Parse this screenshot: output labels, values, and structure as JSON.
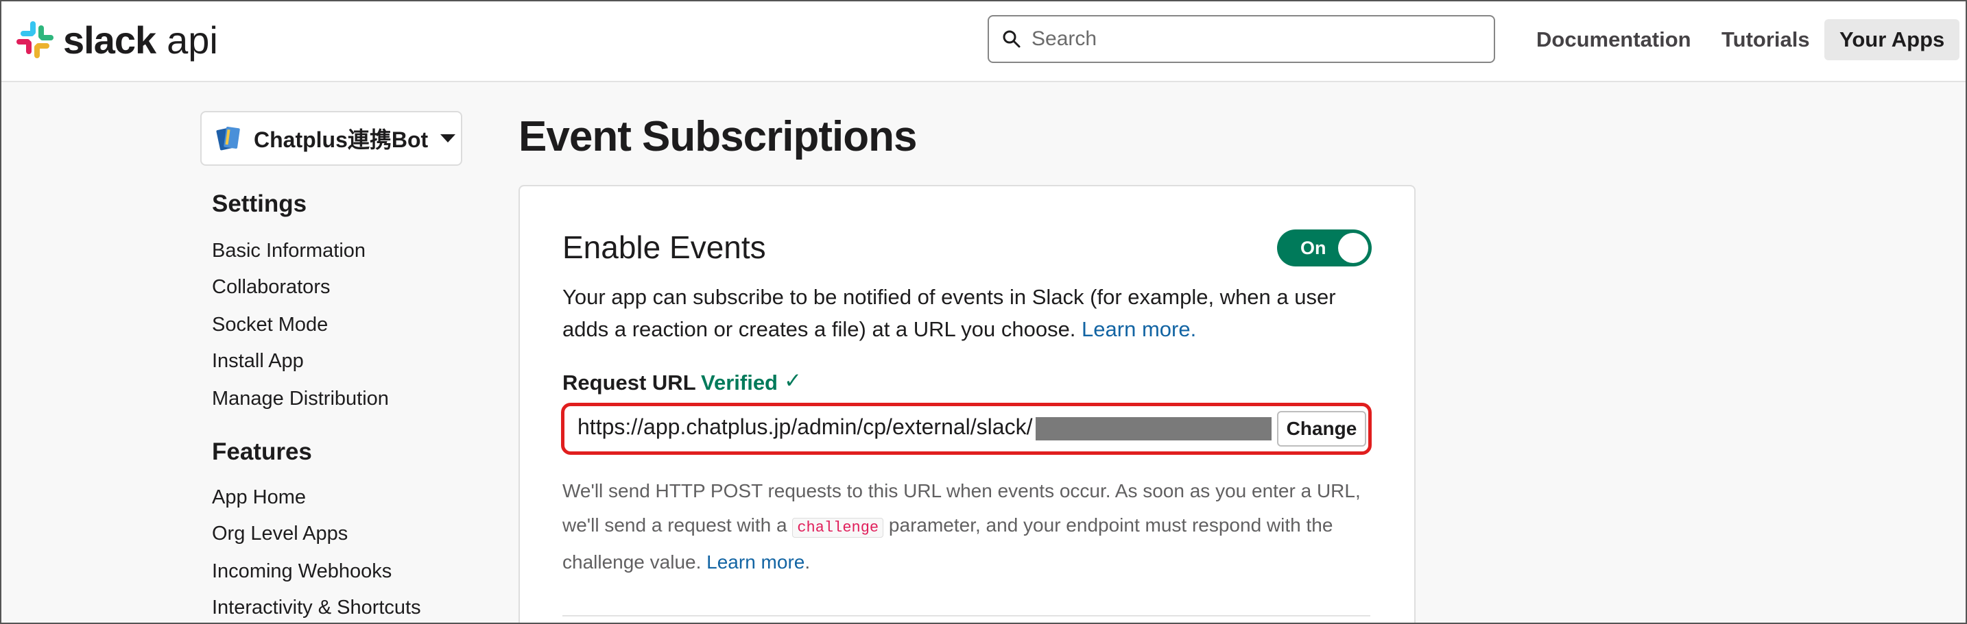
{
  "header": {
    "logo_word": "slack",
    "logo_suffix": "api",
    "search_placeholder": "Search",
    "nav": [
      "Documentation",
      "Tutorials",
      "Your Apps"
    ],
    "active_nav": "Your Apps"
  },
  "sidebar": {
    "app_name": "Chatplus連携Bot",
    "sections": [
      {
        "heading": "Settings",
        "items": [
          "Basic Information",
          "Collaborators",
          "Socket Mode",
          "Install App",
          "Manage Distribution"
        ]
      },
      {
        "heading": "Features",
        "items": [
          "App Home",
          "Org Level Apps",
          "Incoming Webhooks",
          "Interactivity & Shortcuts"
        ]
      }
    ]
  },
  "main": {
    "title": "Event Subscriptions",
    "card_title": "Enable Events",
    "toggle_label": "On",
    "toggle_on": true,
    "description": "Your app can subscribe to be notified of events in Slack (for example, when a user adds a reaction or creates a file) at a URL you choose.",
    "learn_more": "Learn more.",
    "request_url_label": "Request URL",
    "verified_label": "Verified",
    "check_glyph": "✓",
    "request_url": "https://app.chatplus.jp/admin/cp/external/slack/",
    "change_label": "Change",
    "note_part1": "We'll send HTTP POST requests to this URL when events occur. As soon as you enter a URL, we'll send a request with a",
    "note_code": "challenge",
    "note_part2": "parameter, and your endpoint must respond with the challenge value.",
    "note_learn_more": "Learn more",
    "note_period": "."
  },
  "colors": {
    "accent_green": "#007a5a",
    "link_blue": "#1264a3",
    "highlight_red": "#e01e1e",
    "code_pink": "#e01e5a"
  }
}
